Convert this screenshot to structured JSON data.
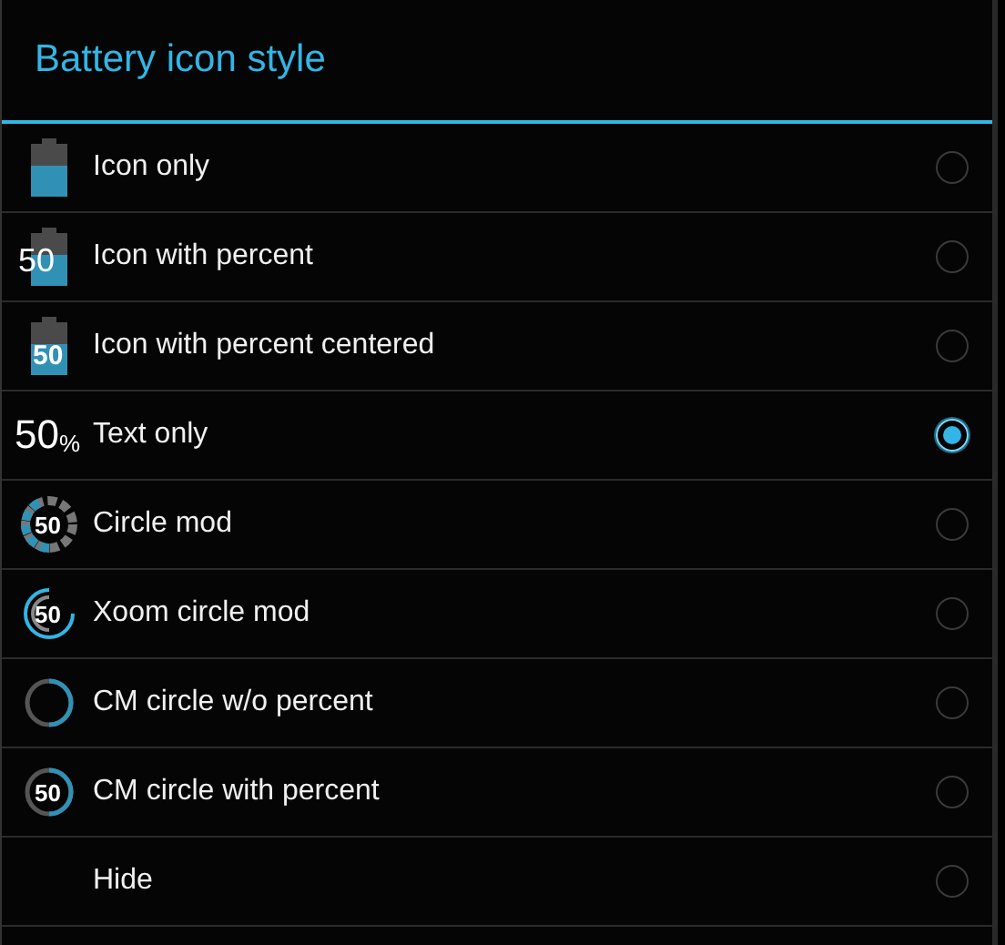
{
  "dialog": {
    "title": "Battery icon style"
  },
  "options": [
    {
      "label": "Icon only",
      "selected": false,
      "kind": "battery"
    },
    {
      "label": "Icon with percent",
      "selected": false,
      "kind": "battery-percent",
      "number": "50"
    },
    {
      "label": "Icon with percent centered",
      "selected": false,
      "kind": "battery-centered",
      "number": "50"
    },
    {
      "label": "Text only",
      "selected": true,
      "kind": "text",
      "number": "50",
      "unit": "%"
    },
    {
      "label": "Circle mod",
      "selected": false,
      "kind": "circle-dashed",
      "number": "50"
    },
    {
      "label": "Xoom circle mod",
      "selected": false,
      "kind": "circle-xoom",
      "number": "50"
    },
    {
      "label": "CM circle w/o percent",
      "selected": false,
      "kind": "circle-cm"
    },
    {
      "label": "CM circle with percent",
      "selected": false,
      "kind": "circle-cm-percent",
      "number": "50"
    },
    {
      "label": "Hide",
      "selected": false,
      "kind": "none"
    }
  ]
}
